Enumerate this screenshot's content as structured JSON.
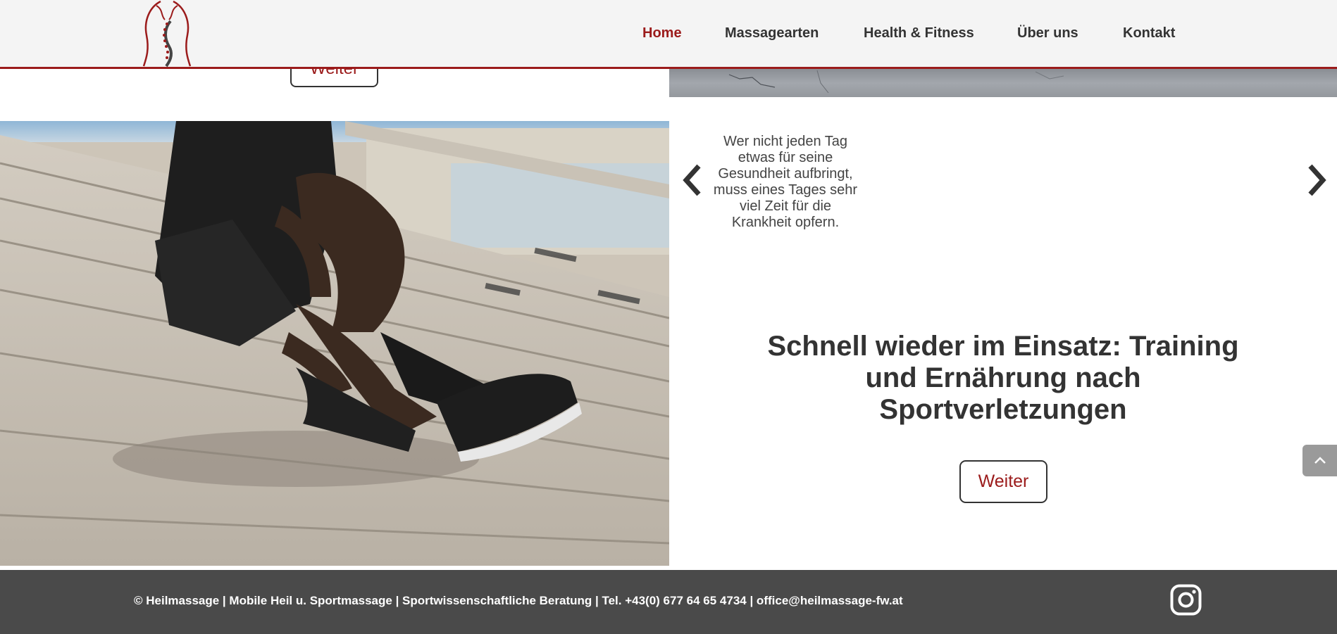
{
  "nav": {
    "items": [
      {
        "label": "Home",
        "active": true
      },
      {
        "label": "Massagearten",
        "active": false
      },
      {
        "label": "Health & Fitness",
        "active": false
      },
      {
        "label": "Über uns",
        "active": false
      },
      {
        "label": "Kontakt",
        "active": false
      }
    ]
  },
  "top_button": {
    "label": "Weiter"
  },
  "slider": {
    "quote": "Wer nicht jeden Tag etwas für seine Gesundheit aufbringt, muss eines Tages sehr viel Zeit für die Krankheit opfern.",
    "prev_icon": "chevron-left-icon",
    "next_icon": "chevron-right-icon"
  },
  "article": {
    "headline": "Schnell wieder im Einsatz: Training und Ernährung nach Sportverletzungen",
    "button_label": "Weiter"
  },
  "scroll_top_icon": "chevron-up-icon",
  "footer": {
    "text": "© Heilmassage | Mobile Heil u. Sportmassage | Sportwissenschaftliche Beratung | Tel. +43(0) 677 64 65 4734 | office@heilmassage-fw.at",
    "social_icon": "instagram-icon"
  },
  "colors": {
    "accent": "#9b1b1b",
    "header_bg": "#f4f4f4",
    "footer_bg": "#4a4a4a",
    "text": "#333333"
  }
}
